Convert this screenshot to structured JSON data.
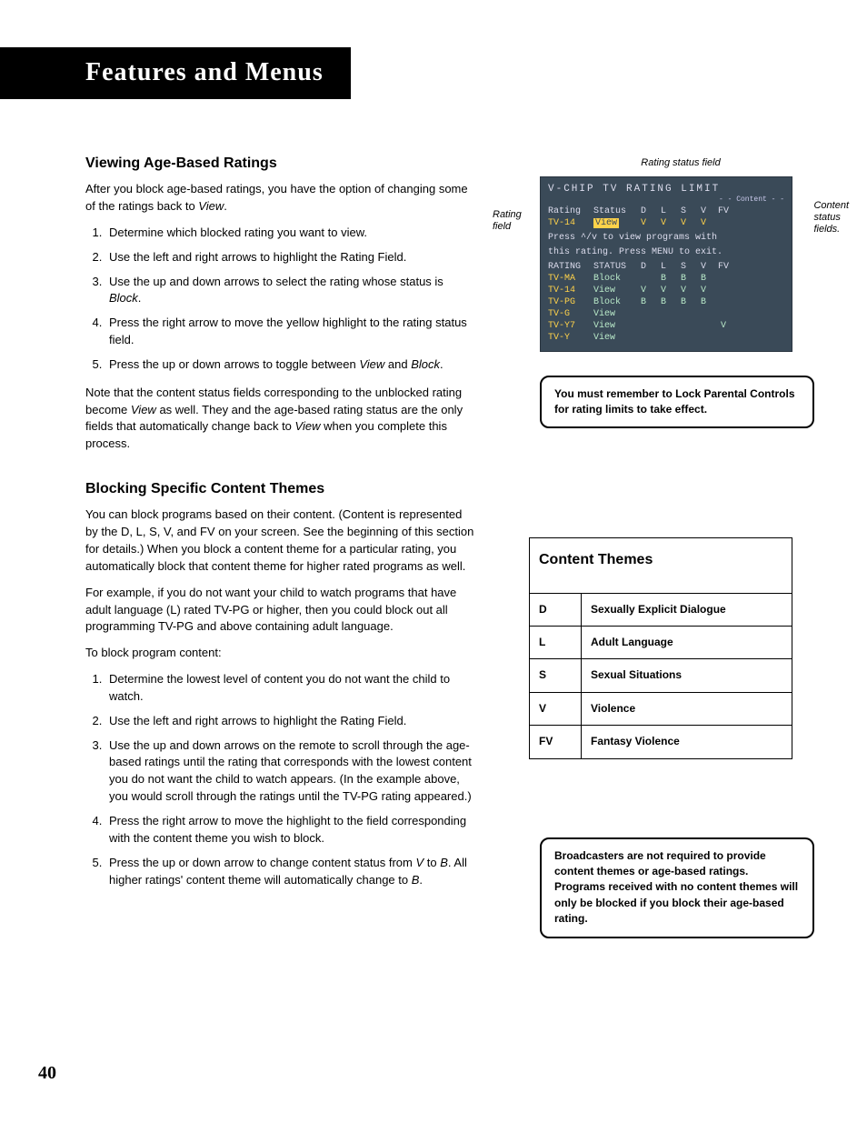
{
  "chapter_title": "Features and Menus",
  "page_number": "40",
  "section1": {
    "heading": "Viewing Age-Based Ratings",
    "intro": "After you block age-based ratings, you have the option of changing some of the ratings back to ",
    "intro_em": "View",
    "intro_end": ".",
    "steps": [
      "Determine which blocked rating you want to view.",
      "Use the left and right arrows to highlight the Rating Field.",
      "Use the up and down arrows to select the rating whose status is Block.",
      "Press the right arrow to move the yellow highlight to the rating status field.",
      "Press the up or down arrows to toggle between View and Block."
    ],
    "note_p1": "Note that the content status fields corresponding to the unblocked rating become ",
    "note_em": "View",
    "note_p2": " as well. They and the age-based rating status are the only fields that automatically change back to ",
    "note_em2": "View",
    "note_p3": " when you complete this process."
  },
  "section2": {
    "heading": "Blocking Specific Content Themes",
    "p1": "You can block programs based on their content. (Content is represented by the D, L, S, V, and FV on your screen. See the beginning of this section for details.) When you block a content theme for a particular rating, you automatically block that content theme for higher rated programs as well.",
    "p2": "For example, if you do not want your child to watch programs that have adult language (L) rated TV-PG or higher, then you could block out all programming TV-PG and above containing adult language.",
    "p3": "To block program content:",
    "steps": [
      "Determine the lowest level of content you do not want the child to watch.",
      "Use the left and right arrows to highlight the Rating Field.",
      "Use the up and down arrows on the remote to scroll through the age-based ratings until the rating that corresponds with the lowest content you do not want the child to watch appears.  (In the example above, you would scroll through the ratings until the TV-PG rating appeared.)",
      "Press the right arrow to move the highlight to the field corresponding with the content theme you wish to block.",
      "Press the up or down arrow to change content status from V to B. All higher ratings' content theme will automatically change to B."
    ]
  },
  "figure": {
    "caption_top": "Rating status field",
    "label_left": "Rating field",
    "label_right": "Content status fields.",
    "osd": {
      "title": "V-CHIP  TV  RATING  LIMIT",
      "content_sub": "- - Content - -",
      "cols": [
        "D",
        "L",
        "S",
        "V",
        "FV"
      ],
      "top_rating": "TV-14",
      "top_status": "View",
      "top_vals": [
        "V",
        "V",
        "V",
        "V",
        ""
      ],
      "msg1": "Press ^/v to view programs with",
      "msg2": "this rating. Press MENU to exit.",
      "hdr_rating": "RATING",
      "hdr_status": "STATUS",
      "rows": [
        {
          "r": "TV-MA",
          "s": "Block",
          "v": [
            "",
            "B",
            "B",
            "B",
            ""
          ]
        },
        {
          "r": "TV-14",
          "s": "View",
          "v": [
            "V",
            "V",
            "V",
            "V",
            ""
          ]
        },
        {
          "r": "TV-PG",
          "s": "Block",
          "v": [
            "B",
            "B",
            "B",
            "B",
            ""
          ]
        },
        {
          "r": "TV-G",
          "s": "View",
          "v": [
            "",
            "",
            "",
            "",
            ""
          ]
        },
        {
          "r": "TV-Y7",
          "s": "View",
          "v": [
            "",
            "",
            "",
            "",
            "V"
          ]
        },
        {
          "r": "TV-Y",
          "s": "View",
          "v": [
            "",
            "",
            "",
            "",
            ""
          ]
        }
      ]
    }
  },
  "callout1": "You must remember to Lock Parental Controls for rating limits to take effect.",
  "content_themes": {
    "title": "Content Themes",
    "rows": [
      {
        "code": "D",
        "desc": "Sexually Explicit Dialogue"
      },
      {
        "code": "L",
        "desc": "Adult Language"
      },
      {
        "code": "S",
        "desc": "Sexual Situations"
      },
      {
        "code": "V",
        "desc": "Violence"
      },
      {
        "code": "FV",
        "desc": "Fantasy Violence"
      }
    ]
  },
  "callout2": "Broadcasters are not required to provide content themes or age-based ratings. Programs received with no content themes will only be blocked if you block their age-based rating."
}
